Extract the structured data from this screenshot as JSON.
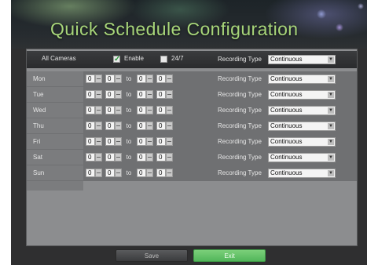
{
  "title": "Quick Schedule Configuration",
  "header": {
    "all_cameras": "All Cameras",
    "enable_label": "Enable",
    "enable_checked": true,
    "always_label": "24/7",
    "always_checked": false,
    "rec_type_label": "Recording Type",
    "rec_type_value": "Continuous"
  },
  "days": [
    {
      "label": "Mon",
      "start_h": "0",
      "start_m": "0",
      "to": "to",
      "end_h": "0",
      "end_m": "0",
      "rec_label": "Recording Type",
      "rec_value": "Continuous"
    },
    {
      "label": "Tue",
      "start_h": "0",
      "start_m": "0",
      "to": "to",
      "end_h": "0",
      "end_m": "0",
      "rec_label": "Recording Type",
      "rec_value": "Continuous"
    },
    {
      "label": "Wed",
      "start_h": "0",
      "start_m": "0",
      "to": "to",
      "end_h": "0",
      "end_m": "0",
      "rec_label": "Recording Type",
      "rec_value": "Continuous"
    },
    {
      "label": "Thu",
      "start_h": "0",
      "start_m": "0",
      "to": "to",
      "end_h": "0",
      "end_m": "0",
      "rec_label": "Recording Type",
      "rec_value": "Continuous"
    },
    {
      "label": "Fri",
      "start_h": "0",
      "start_m": "0",
      "to": "to",
      "end_h": "0",
      "end_m": "0",
      "rec_label": "Recording Type",
      "rec_value": "Continuous"
    },
    {
      "label": "Sat",
      "start_h": "0",
      "start_m": "0",
      "to": "to",
      "end_h": "0",
      "end_m": "0",
      "rec_label": "Recording Type",
      "rec_value": "Continuous"
    },
    {
      "label": "Sun",
      "start_h": "0",
      "start_m": "0",
      "to": "to",
      "end_h": "0",
      "end_m": "0",
      "rec_label": "Recording Type",
      "rec_value": "Continuous"
    }
  ],
  "buttons": {
    "save": "Save",
    "exit": "Exit"
  },
  "icons": {
    "checkbox_check": "check-icon",
    "dropdown": "chevron-down-icon",
    "spinner": "spinner-icon"
  },
  "colors": {
    "title": "#a8d67a",
    "exit_button": "#5ec263",
    "check": "#2e9a3e"
  }
}
